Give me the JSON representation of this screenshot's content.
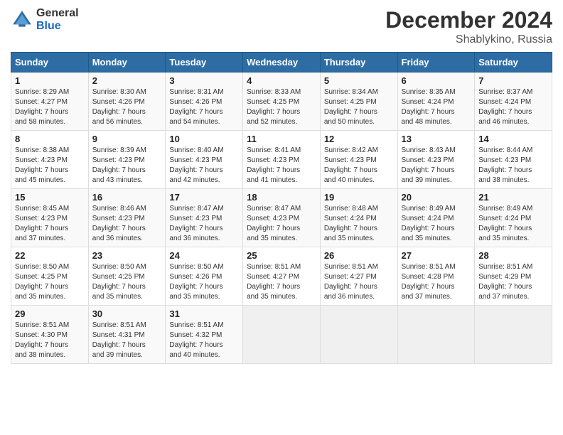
{
  "header": {
    "logo_general": "General",
    "logo_blue": "Blue",
    "month_title": "December 2024",
    "location": "Shablykino, Russia"
  },
  "days_of_week": [
    "Sunday",
    "Monday",
    "Tuesday",
    "Wednesday",
    "Thursday",
    "Friday",
    "Saturday"
  ],
  "weeks": [
    [
      {
        "day": "1",
        "info": "Sunrise: 8:29 AM\nSunset: 4:27 PM\nDaylight: 7 hours\nand 58 minutes."
      },
      {
        "day": "2",
        "info": "Sunrise: 8:30 AM\nSunset: 4:26 PM\nDaylight: 7 hours\nand 56 minutes."
      },
      {
        "day": "3",
        "info": "Sunrise: 8:31 AM\nSunset: 4:26 PM\nDaylight: 7 hours\nand 54 minutes."
      },
      {
        "day": "4",
        "info": "Sunrise: 8:33 AM\nSunset: 4:25 PM\nDaylight: 7 hours\nand 52 minutes."
      },
      {
        "day": "5",
        "info": "Sunrise: 8:34 AM\nSunset: 4:25 PM\nDaylight: 7 hours\nand 50 minutes."
      },
      {
        "day": "6",
        "info": "Sunrise: 8:35 AM\nSunset: 4:24 PM\nDaylight: 7 hours\nand 48 minutes."
      },
      {
        "day": "7",
        "info": "Sunrise: 8:37 AM\nSunset: 4:24 PM\nDaylight: 7 hours\nand 46 minutes."
      }
    ],
    [
      {
        "day": "8",
        "info": "Sunrise: 8:38 AM\nSunset: 4:23 PM\nDaylight: 7 hours\nand 45 minutes."
      },
      {
        "day": "9",
        "info": "Sunrise: 8:39 AM\nSunset: 4:23 PM\nDaylight: 7 hours\nand 43 minutes."
      },
      {
        "day": "10",
        "info": "Sunrise: 8:40 AM\nSunset: 4:23 PM\nDaylight: 7 hours\nand 42 minutes."
      },
      {
        "day": "11",
        "info": "Sunrise: 8:41 AM\nSunset: 4:23 PM\nDaylight: 7 hours\nand 41 minutes."
      },
      {
        "day": "12",
        "info": "Sunrise: 8:42 AM\nSunset: 4:23 PM\nDaylight: 7 hours\nand 40 minutes."
      },
      {
        "day": "13",
        "info": "Sunrise: 8:43 AM\nSunset: 4:23 PM\nDaylight: 7 hours\nand 39 minutes."
      },
      {
        "day": "14",
        "info": "Sunrise: 8:44 AM\nSunset: 4:23 PM\nDaylight: 7 hours\nand 38 minutes."
      }
    ],
    [
      {
        "day": "15",
        "info": "Sunrise: 8:45 AM\nSunset: 4:23 PM\nDaylight: 7 hours\nand 37 minutes."
      },
      {
        "day": "16",
        "info": "Sunrise: 8:46 AM\nSunset: 4:23 PM\nDaylight: 7 hours\nand 36 minutes."
      },
      {
        "day": "17",
        "info": "Sunrise: 8:47 AM\nSunset: 4:23 PM\nDaylight: 7 hours\nand 36 minutes."
      },
      {
        "day": "18",
        "info": "Sunrise: 8:47 AM\nSunset: 4:23 PM\nDaylight: 7 hours\nand 35 minutes."
      },
      {
        "day": "19",
        "info": "Sunrise: 8:48 AM\nSunset: 4:24 PM\nDaylight: 7 hours\nand 35 minutes."
      },
      {
        "day": "20",
        "info": "Sunrise: 8:49 AM\nSunset: 4:24 PM\nDaylight: 7 hours\nand 35 minutes."
      },
      {
        "day": "21",
        "info": "Sunrise: 8:49 AM\nSunset: 4:24 PM\nDaylight: 7 hours\nand 35 minutes."
      }
    ],
    [
      {
        "day": "22",
        "info": "Sunrise: 8:50 AM\nSunset: 4:25 PM\nDaylight: 7 hours\nand 35 minutes."
      },
      {
        "day": "23",
        "info": "Sunrise: 8:50 AM\nSunset: 4:25 PM\nDaylight: 7 hours\nand 35 minutes."
      },
      {
        "day": "24",
        "info": "Sunrise: 8:50 AM\nSunset: 4:26 PM\nDaylight: 7 hours\nand 35 minutes."
      },
      {
        "day": "25",
        "info": "Sunrise: 8:51 AM\nSunset: 4:27 PM\nDaylight: 7 hours\nand 35 minutes."
      },
      {
        "day": "26",
        "info": "Sunrise: 8:51 AM\nSunset: 4:27 PM\nDaylight: 7 hours\nand 36 minutes."
      },
      {
        "day": "27",
        "info": "Sunrise: 8:51 AM\nSunset: 4:28 PM\nDaylight: 7 hours\nand 37 minutes."
      },
      {
        "day": "28",
        "info": "Sunrise: 8:51 AM\nSunset: 4:29 PM\nDaylight: 7 hours\nand 37 minutes."
      }
    ],
    [
      {
        "day": "29",
        "info": "Sunrise: 8:51 AM\nSunset: 4:30 PM\nDaylight: 7 hours\nand 38 minutes."
      },
      {
        "day": "30",
        "info": "Sunrise: 8:51 AM\nSunset: 4:31 PM\nDaylight: 7 hours\nand 39 minutes."
      },
      {
        "day": "31",
        "info": "Sunrise: 8:51 AM\nSunset: 4:32 PM\nDaylight: 7 hours\nand 40 minutes."
      },
      {
        "day": "",
        "info": ""
      },
      {
        "day": "",
        "info": ""
      },
      {
        "day": "",
        "info": ""
      },
      {
        "day": "",
        "info": ""
      }
    ]
  ]
}
